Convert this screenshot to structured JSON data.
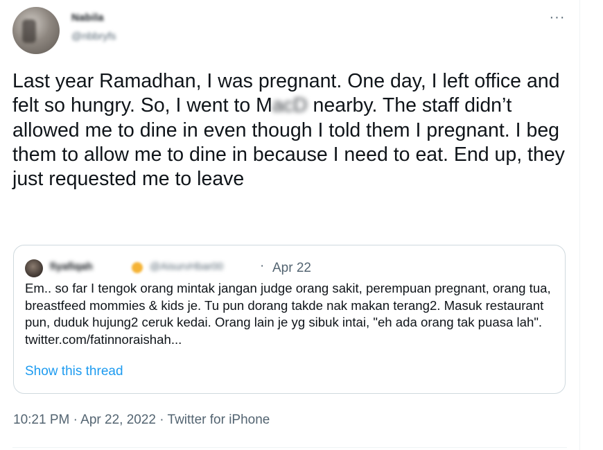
{
  "tweet": {
    "author_name": "Nabila",
    "author_handle": "@nbbryfs",
    "more_label": "···",
    "text_before": "Last year Ramadhan, I was pregnant. One day, I left office and felt so hungry. So, I went to M",
    "text_blurred": "acD",
    "text_after": " nearby. The staff didn’t allowed me to dine in even though I told them I pregnant. I beg them to allow me to dine in because I need to eat. End up, they just requested me to leave"
  },
  "quote": {
    "author_name": "fiyafiqah",
    "author_handle": "@AisurvHbar00",
    "separator": "·",
    "date": "Apr 22",
    "text": "Em.. so far I tengok orang mintak jangan judge orang sakit, perempuan pregnant, orang tua, breastfeed mommies & kids je. Tu pun dorang takde nak makan terang2. Masuk restaurant pun, duduk hujung2 ceruk kedai. Orang lain je yg sibuk intai, \"eh ada orang tak puasa lah\". twitter.com/fatinnoraishah...",
    "show_thread": "Show this thread"
  },
  "meta": {
    "time": "10:21 PM",
    "sep1": " · ",
    "date": "Apr 22, 2022",
    "sep2": " · ",
    "source": "Twitter for iPhone"
  },
  "colors": {
    "text": "#0f1419",
    "secondary": "#536471",
    "link": "#1d9bf0",
    "border": "#cfd9de"
  }
}
